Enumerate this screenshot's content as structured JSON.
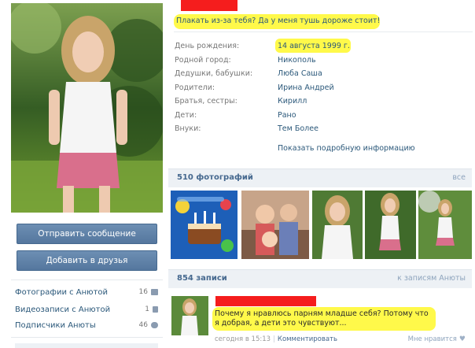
{
  "left": {
    "avatar_alt": "profile photo",
    "buttons": {
      "send_message": "Отправить сообщение",
      "add_friend": "Добавить в друзья"
    },
    "links": [
      {
        "label": "Фотографии с Анютой",
        "count": "16",
        "icon": "camera-icon"
      },
      {
        "label": "Видеозаписи с Анютой",
        "count": "1",
        "icon": "video-icon"
      },
      {
        "label": "Подписчики Анюты",
        "count": "46",
        "icon": "users-icon"
      }
    ]
  },
  "profile": {
    "status": "Плакать из-за тебя? Да у меня тушь дороже стоит!",
    "info": [
      {
        "label": "День рождения:",
        "value": "14 августа 1999 г."
      },
      {
        "label": "Родной город:",
        "value": "Никополь"
      },
      {
        "label": "Дедушки, бабушки:",
        "value": "Люба Саша"
      },
      {
        "label": "Родители:",
        "value": "Ирина Андрей"
      },
      {
        "label": "Братья, сестры:",
        "value": "Кирилл"
      },
      {
        "label": "Дети:",
        "value": "Рано"
      },
      {
        "label": "Внуки:",
        "value": "Тем Более"
      }
    ],
    "show_details": "Показать подробную информацию"
  },
  "photos": {
    "title": "510 фотографий",
    "all_link": "все"
  },
  "wall": {
    "title": "854 записи",
    "link": "к записям Анюты",
    "post": {
      "text": "Почему я нравлюсь парням младше себя? Потому что я добрая, а дети это чувствуют...",
      "time": "сегодня в 15:13",
      "comment": "Комментировать",
      "like": "Мне нравится"
    }
  },
  "colors": {
    "link": "#2b587a",
    "highlight": "#fff94a",
    "redaction": "#f51d1d",
    "button": "#5f82a8"
  }
}
